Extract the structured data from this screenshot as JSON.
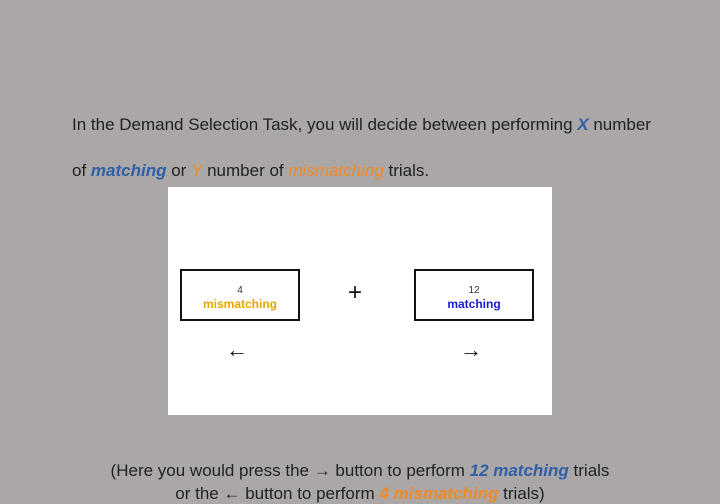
{
  "intro": {
    "line1_prefix": "In the Demand Selection Task, you will decide between performing ",
    "x_var": "X",
    "line1_suffix": " number",
    "line2_prefix": "of ",
    "matching_word": "matching",
    "line2_or": " or ",
    "y_var": "Y",
    "line2_mid": " number of ",
    "mismatching_word": "mismatching",
    "line2_suffix": " trials."
  },
  "example": {
    "left_choice": {
      "count": "4",
      "label": "mismatching"
    },
    "right_choice": {
      "count": "12",
      "label": "matching"
    },
    "fixation": "+",
    "left_arrow": "←",
    "right_arrow": "→"
  },
  "instruction": {
    "line1_prefix": "(Here you would press the ",
    "right_arrow_glyph": "→",
    "line1_mid": " button to perform ",
    "line1_highlight": "12 matching",
    "line1_suffix": " trials",
    "line2_prefix": "or the ",
    "left_arrow_glyph": "←",
    "line2_mid": " button to perform ",
    "line2_highlight": "4 mismatching",
    "line2_suffix": " trials)"
  },
  "colors": {
    "background": "#aaa7a6",
    "matching_blue": "#2f5fa8",
    "mismatching_orange": "#f08a24"
  }
}
